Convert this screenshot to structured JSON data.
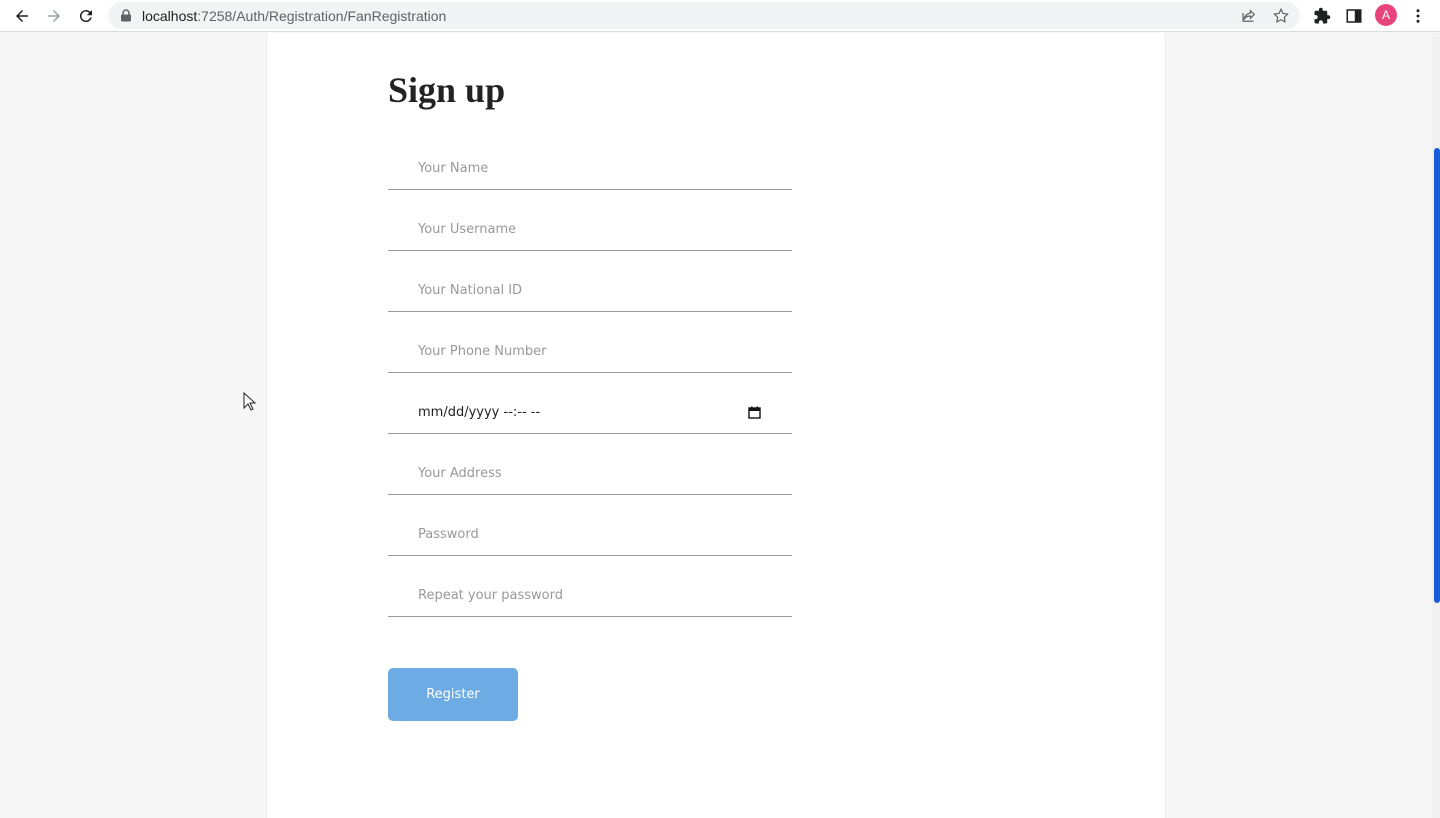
{
  "browser": {
    "url_host": "localhost",
    "url_path": ":7258/Auth/Registration/FanRegistration",
    "avatar_letter": "A",
    "icons": [
      "back-icon",
      "forward-icon",
      "reload-icon",
      "lock-icon",
      "share-icon",
      "star-icon",
      "extensions-icon",
      "sidepanel-icon",
      "menu-icon"
    ]
  },
  "page": {
    "title": "Sign up",
    "fields": {
      "name": "Your Name",
      "username": "Your Username",
      "national_id": "Your National ID",
      "phone": "Your Phone Number",
      "datetime": "mm/dd/yyyy --:-- --",
      "address": "Your Address",
      "password": "Password",
      "repeat_password": "Repeat your password"
    },
    "register_label": "Register"
  },
  "colors": {
    "button": "#6dabe4",
    "scroll_thumb": "#1a5bd8",
    "avatar": "#e8457d"
  }
}
